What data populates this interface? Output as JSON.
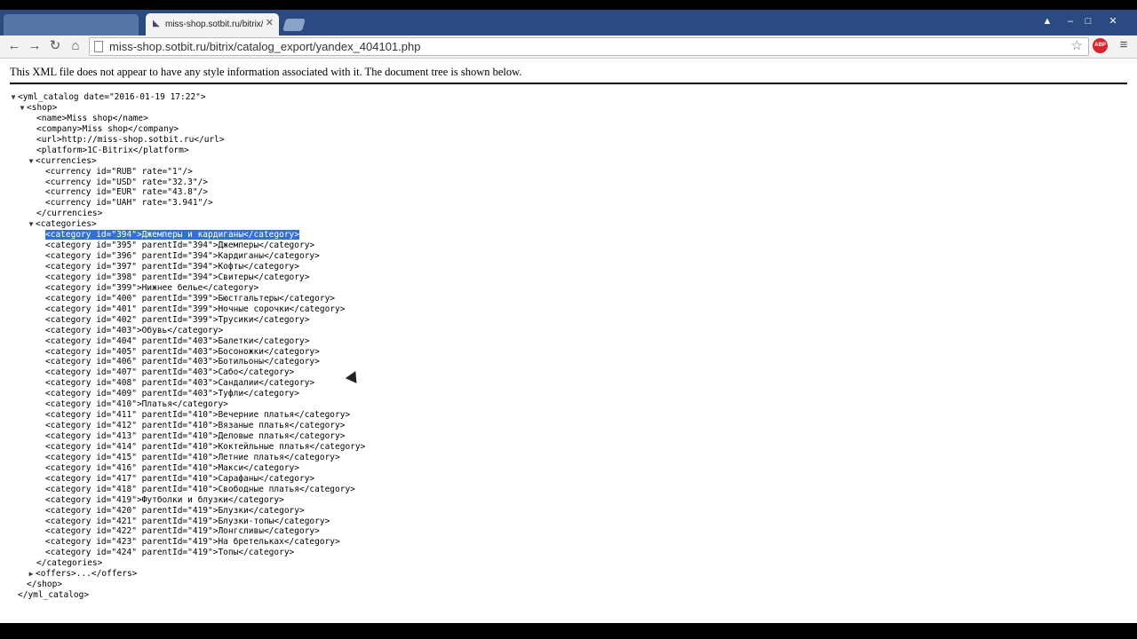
{
  "browser": {
    "tab_title": "miss-shop.sotbit.ru/bitrix/",
    "url": "miss-shop.sotbit.ru/bitrix/catalog_export/yandex_404101.php",
    "ext_label": "ABP"
  },
  "page": {
    "info": "This XML file does not appear to have any style information associated with it. The document tree is shown below."
  },
  "xml": {
    "root_open": "<yml_catalog date=\"2016-01-19 17:22\">",
    "shop_open": "<shop>",
    "name": "<name>Miss shop</name>",
    "company": "<company>Miss shop</company>",
    "url": "<url>http://miss-shop.sotbit.ru</url>",
    "platform": "<platform>1C-Bitrix</platform>",
    "currencies_open": "<currencies>",
    "currencies": [
      "<currency id=\"RUB\" rate=\"1\"/>",
      "<currency id=\"USD\" rate=\"32.3\"/>",
      "<currency id=\"EUR\" rate=\"43.8\"/>",
      "<currency id=\"UAH\" rate=\"3.941\"/>"
    ],
    "currencies_close": "</currencies>",
    "categories_open": "<categories>",
    "categories": [
      "<category id=\"394\">Джемперы и кардиганы</category>",
      "<category id=\"395\" parentId=\"394\">Джемперы</category>",
      "<category id=\"396\" parentId=\"394\">Кардиганы</category>",
      "<category id=\"397\" parentId=\"394\">Кофты</category>",
      "<category id=\"398\" parentId=\"394\">Свитеры</category>",
      "<category id=\"399\">Нижнее белье</category>",
      "<category id=\"400\" parentId=\"399\">Бюстгальтеры</category>",
      "<category id=\"401\" parentId=\"399\">Ночные сорочки</category>",
      "<category id=\"402\" parentId=\"399\">Трусики</category>",
      "<category id=\"403\">Обувь</category>",
      "<category id=\"404\" parentId=\"403\">Балетки</category>",
      "<category id=\"405\" parentId=\"403\">Босоножки</category>",
      "<category id=\"406\" parentId=\"403\">Ботильоны</category>",
      "<category id=\"407\" parentId=\"403\">Сабо</category>",
      "<category id=\"408\" parentId=\"403\">Сандалии</category>",
      "<category id=\"409\" parentId=\"403\">Туфли</category>",
      "<category id=\"410\">Платья</category>",
      "<category id=\"411\" parentId=\"410\">Вечерние платья</category>",
      "<category id=\"412\" parentId=\"410\">Вязаные платья</category>",
      "<category id=\"413\" parentId=\"410\">Деловые платья</category>",
      "<category id=\"414\" parentId=\"410\">Коктейльные платья</category>",
      "<category id=\"415\" parentId=\"410\">Летние платья</category>",
      "<category id=\"416\" parentId=\"410\">Макси</category>",
      "<category id=\"417\" parentId=\"410\">Сарафаны</category>",
      "<category id=\"418\" parentId=\"410\">Свободные платья</category>",
      "<category id=\"419\">Футболки и блузки</category>",
      "<category id=\"420\" parentId=\"419\">Блузки</category>",
      "<category id=\"421\" parentId=\"419\">Блузки-топы</category>",
      "<category id=\"422\" parentId=\"419\">Лонгсливы</category>",
      "<category id=\"423\" parentId=\"419\">На бретельках</category>",
      "<category id=\"424\" parentId=\"419\">Топы</category>"
    ],
    "categories_close": "</categories>",
    "offers": "<offers>...</offers>",
    "shop_close": "</shop>",
    "root_close": "</yml_catalog>"
  },
  "icons": {
    "expanded": "▼",
    "collapsed": "▶"
  }
}
